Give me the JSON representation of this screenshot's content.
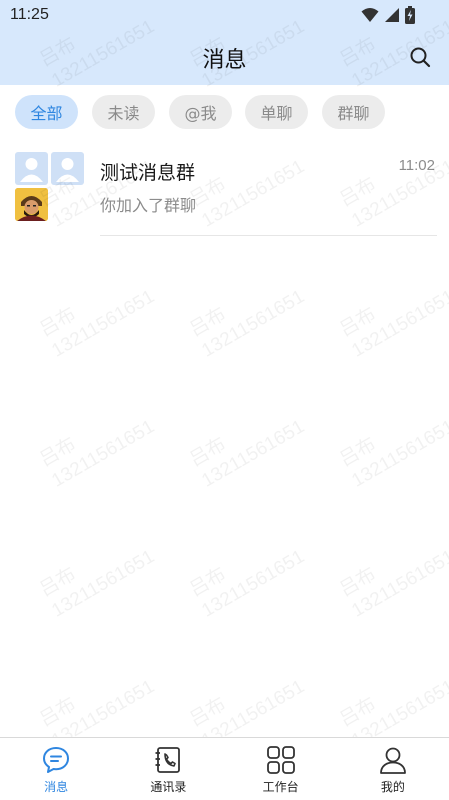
{
  "status_bar": {
    "time": "11:25"
  },
  "header": {
    "title": "消息"
  },
  "filters": [
    {
      "label": "全部",
      "active": true
    },
    {
      "label": "未读",
      "active": false
    },
    {
      "label": "@我",
      "active": false
    },
    {
      "label": "单聊",
      "active": false
    },
    {
      "label": "群聊",
      "active": false
    }
  ],
  "conversations": [
    {
      "name": "测试消息群",
      "preview": "你加入了群聊",
      "time": "11:02"
    }
  ],
  "watermark": {
    "name": "吕布",
    "id": "13211561651"
  },
  "tabbar": [
    {
      "label": "消息",
      "icon": "chat-icon",
      "active": true
    },
    {
      "label": "通讯录",
      "icon": "contacts-icon",
      "active": false
    },
    {
      "label": "工作台",
      "icon": "grid-icon",
      "active": false
    },
    {
      "label": "我的",
      "icon": "profile-icon",
      "active": false
    }
  ],
  "colors": {
    "header_bg": "#d7e8fc",
    "accent": "#2f86e0",
    "chip_bg": "#ececec",
    "chip_active_bg": "#cfe3fb"
  }
}
